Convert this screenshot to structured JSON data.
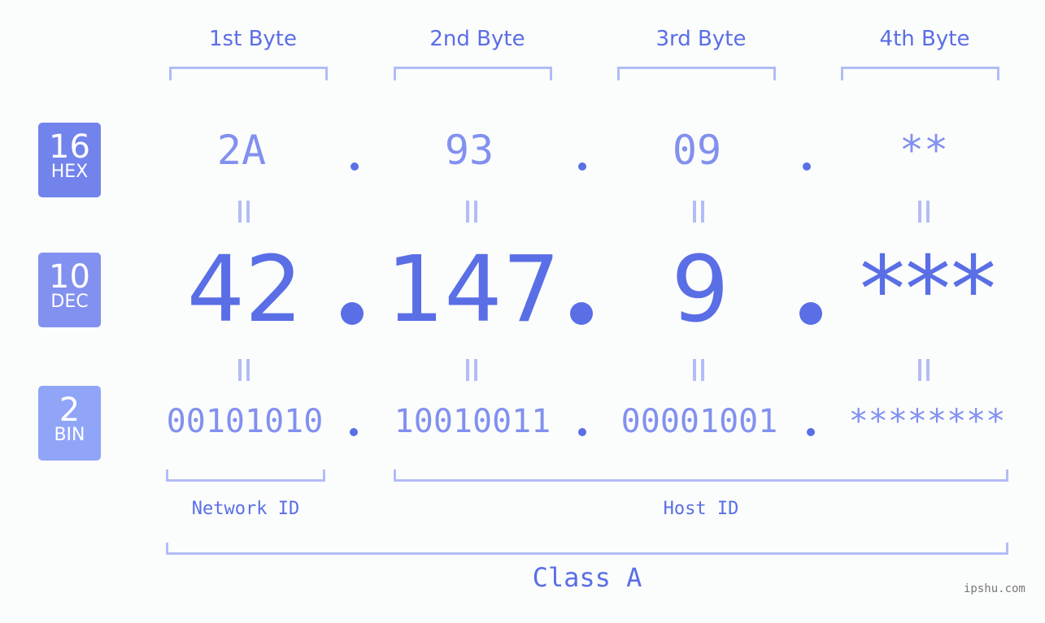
{
  "bytes": [
    {
      "header": "1st Byte",
      "hex": "2A",
      "dec": "42",
      "bin": "00101010"
    },
    {
      "header": "2nd Byte",
      "hex": "93",
      "dec": "147",
      "bin": "10010011"
    },
    {
      "header": "3rd Byte",
      "hex": "09",
      "dec": "9",
      "bin": "00001001"
    },
    {
      "header": "4th Byte",
      "hex": "**",
      "dec": "***",
      "bin": "********"
    }
  ],
  "badges": {
    "hex": {
      "num": "16",
      "label": "HEX",
      "color": "#7383ec"
    },
    "dec": {
      "num": "10",
      "label": "DEC",
      "color": "#8290ef"
    },
    "bin": {
      "num": "2",
      "label": "BIN",
      "color": "#90a5f8"
    }
  },
  "labels": {
    "network_id": "Network ID",
    "host_id": "Host ID",
    "class": "Class A"
  },
  "watermark": "ipshu.com",
  "colors": {
    "accent": "#5a6ee6",
    "light": "#8290ef",
    "bracket": "#b3bcf7"
  }
}
